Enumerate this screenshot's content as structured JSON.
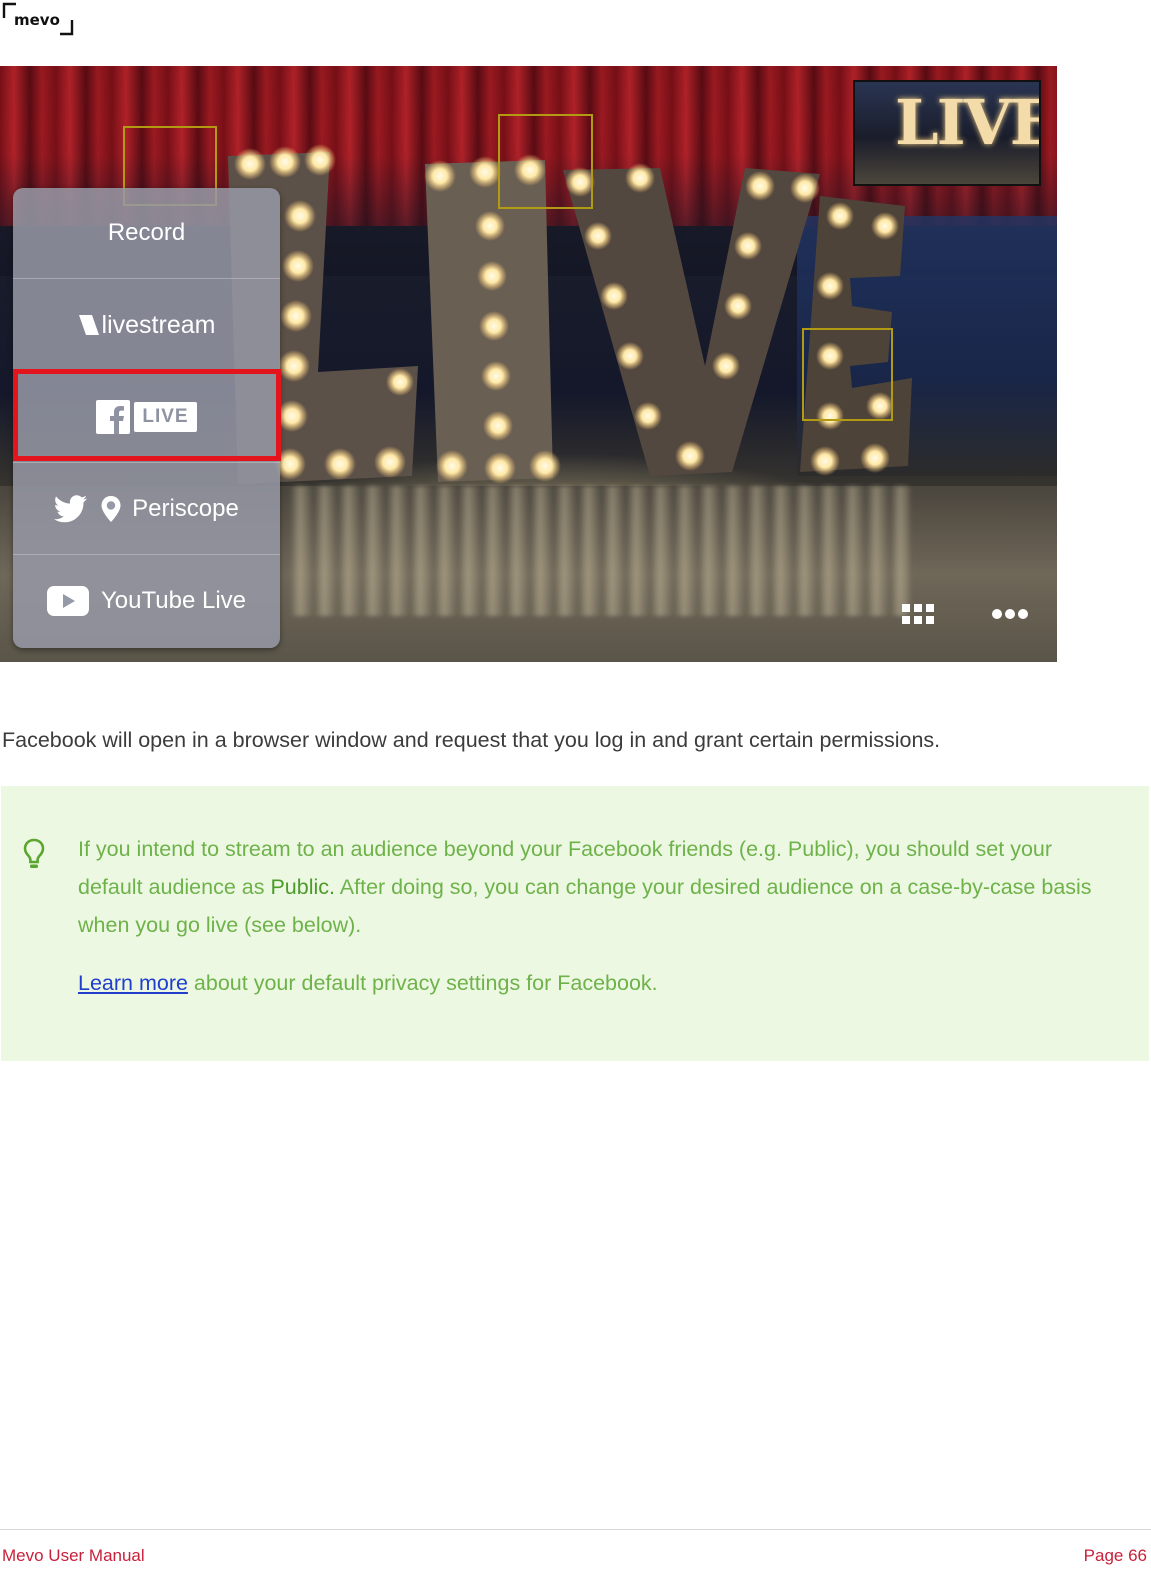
{
  "brand": {
    "logo_text": "mevo"
  },
  "screenshot": {
    "preview_text": "LIVE",
    "menu": {
      "items": [
        {
          "label": "Record",
          "icons": []
        },
        {
          "label": "livestream",
          "icons": [
            "livestream-logo-icon"
          ]
        },
        {
          "label": "LIVE",
          "icons": [
            "facebook-icon"
          ],
          "highlighted": true
        },
        {
          "label": "Periscope",
          "icons": [
            "twitter-icon",
            "periscope-icon"
          ]
        },
        {
          "label": "YouTube Live",
          "icons": [
            "youtube-icon"
          ]
        }
      ]
    },
    "controls": [
      "grid-icon",
      "more-icon"
    ],
    "colors": {
      "highlight": "#e3141b",
      "focus_box": "#b39a13"
    }
  },
  "content": {
    "intro": "Facebook will open in a browser window and request that you log in and grant certain permissions.",
    "tip": {
      "icon": "lightbulb-icon",
      "part1": "If you intend to stream to an audience beyond your Facebook friends (e.g. Public), you should set your default audience as ",
      "emphasis": "Public.",
      "part2": " After doing so, you can change your desired audience on a case-by-case basis when you go live (see below).",
      "link_text": "Learn more",
      "link_after": " about your default privacy settings for Facebook."
    }
  },
  "footer": {
    "left": "Mevo User Manual",
    "right": "Page 66"
  },
  "colors": {
    "tip_background": "#edf8e3",
    "tip_text": "#6eb24a",
    "link": "#1f3fcc",
    "footer_text": "#c8213b"
  }
}
